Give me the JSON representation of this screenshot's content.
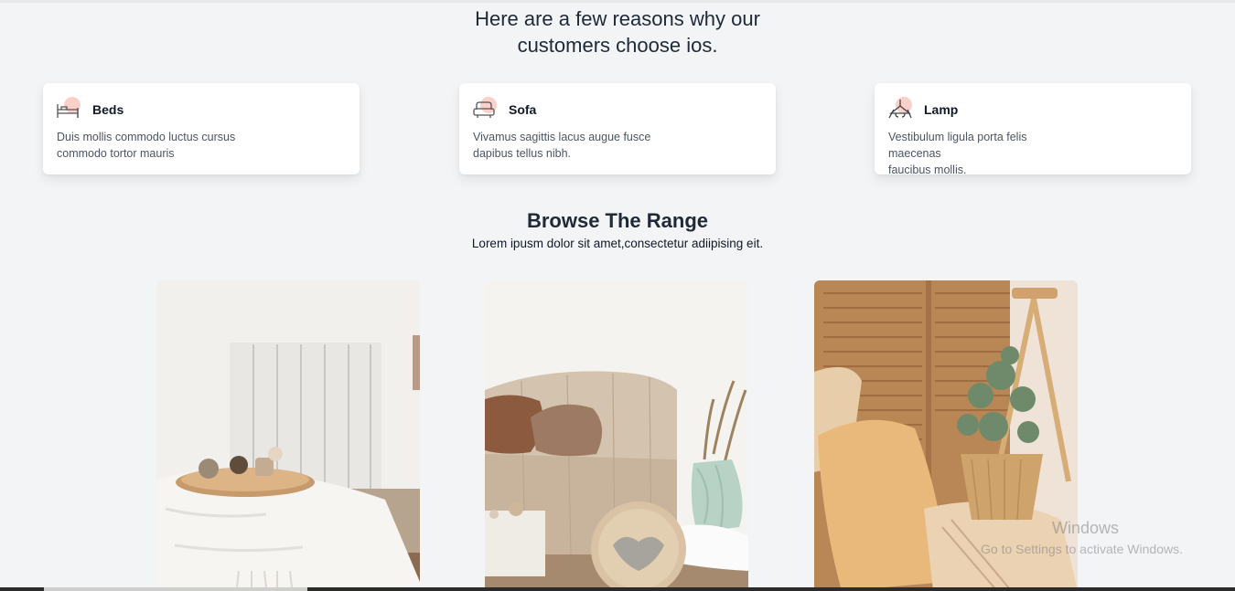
{
  "reasons": {
    "title_line1": "Here are a few reasons why our",
    "title_line2": "customers choose ios."
  },
  "features": [
    {
      "title": "Beds",
      "icon": "bed-icon",
      "line1": "Duis mollis commodo luctus cursus",
      "line2": "commodo tortor mauris"
    },
    {
      "title": "Sofa",
      "icon": "sofa-icon",
      "line1": "Vivamus sagittis lacus augue fusce",
      "line2": "dapibus tellus nibh."
    },
    {
      "title": "Lamp",
      "icon": "lamp-icon",
      "line1": "Vestibulum ligula porta felis maecenas",
      "line2": "faucibus mollis."
    }
  ],
  "range": {
    "title": "Browse The Range",
    "subtitle": "Lorem ipusm dolor sit amet,consectetur adiipising eit."
  },
  "watermark": {
    "title": "Windows",
    "subtitle": "Go to Settings to activate Windows."
  },
  "colors": {
    "page_bg": "#f3f4f6",
    "icon_accent": "#f9c9c1",
    "heading": "#1f2937"
  }
}
